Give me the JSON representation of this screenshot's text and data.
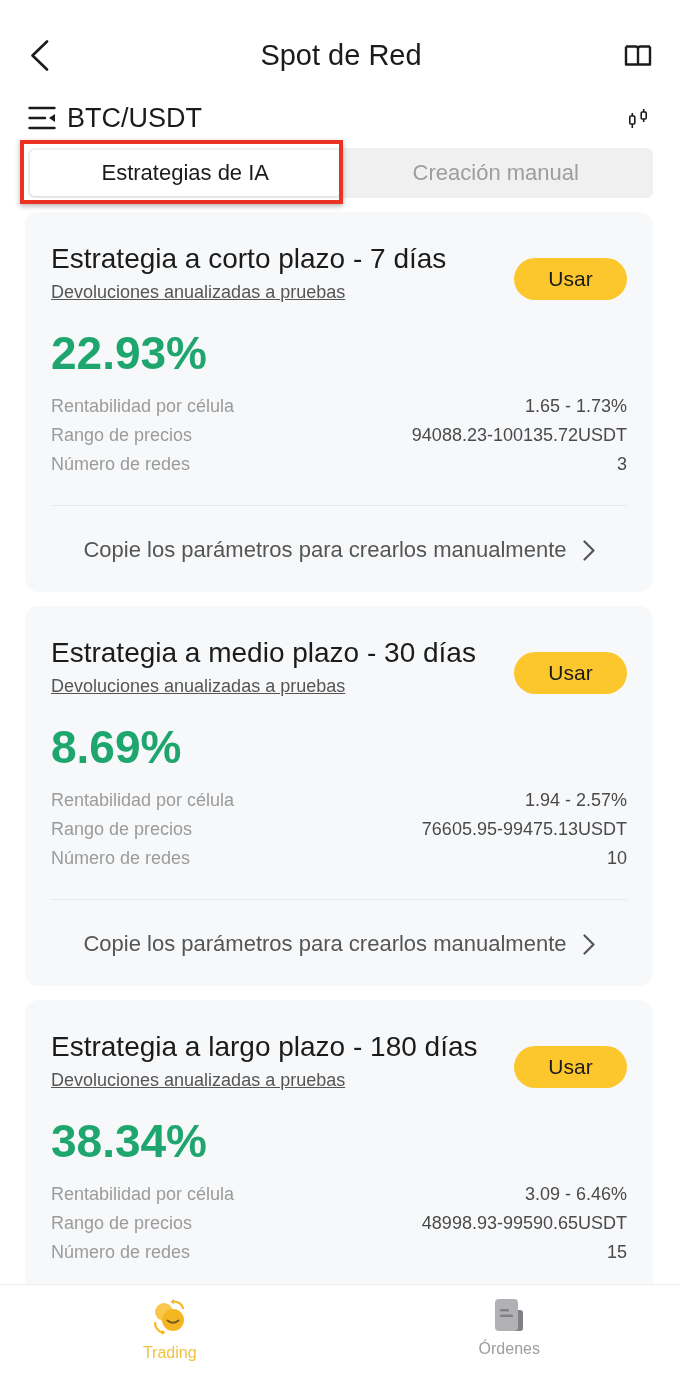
{
  "header": {
    "title": "Spot de Red"
  },
  "pair": {
    "symbol": "BTC/USDT"
  },
  "tabs": [
    {
      "label": "Estrategias de IA",
      "selected": true,
      "highlighted": true
    },
    {
      "label": "Creación manual",
      "selected": false,
      "highlighted": false
    }
  ],
  "strategies": [
    {
      "title": "Estrategia a corto plazo - 7 días",
      "subtitle": "Devoluciones anualizadas a pruebas",
      "button": "Usar",
      "return_rate": "22.93%",
      "stats": [
        {
          "label": "Rentabilidad por célula",
          "value": "1.65 - 1.73%"
        },
        {
          "label": "Rango de precios",
          "value": "94088.23-100135.72USDT"
        },
        {
          "label": "Número de redes",
          "value": "3"
        }
      ],
      "copy_link": "Copie los parámetros para crearlos manualmente"
    },
    {
      "title": "Estrategia a medio plazo - 30 días",
      "subtitle": "Devoluciones anualizadas a pruebas",
      "button": "Usar",
      "return_rate": "8.69%",
      "stats": [
        {
          "label": "Rentabilidad por célula",
          "value": "1.94 - 2.57%"
        },
        {
          "label": "Rango de precios",
          "value": "76605.95-99475.13USDT"
        },
        {
          "label": "Número de redes",
          "value": "10"
        }
      ],
      "copy_link": "Copie los parámetros para crearlos manualmente"
    },
    {
      "title": "Estrategia a largo plazo - 180 días",
      "subtitle": "Devoluciones anualizadas a pruebas",
      "button": "Usar",
      "return_rate": "38.34%",
      "stats": [
        {
          "label": "Rentabilidad por célula",
          "value": "3.09 - 6.46%"
        },
        {
          "label": "Rango de precios",
          "value": "48998.93-99590.65USDT"
        },
        {
          "label": "Número de redes",
          "value": "15"
        }
      ]
    }
  ],
  "bottom_nav": [
    {
      "label": "Trading",
      "selected": true
    },
    {
      "label": "Órdenes",
      "selected": false
    }
  ]
}
